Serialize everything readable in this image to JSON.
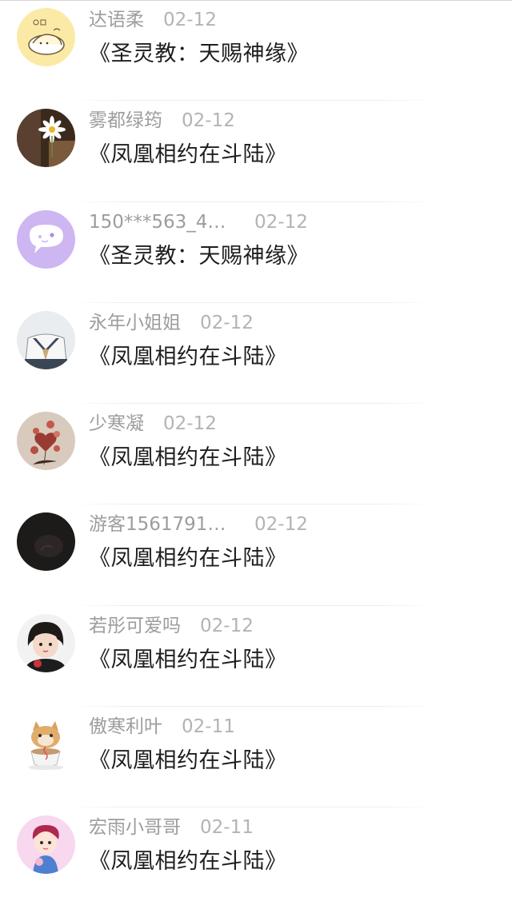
{
  "comments": [
    {
      "user": "达语柔",
      "date": "02-12",
      "book": "《圣灵教：天赐神缘》",
      "avatar": "bread-cat-avatar",
      "avatar_bg": "#fbeaa6"
    },
    {
      "user": "雾都绿筠",
      "date": "02-12",
      "book": "《凤凰相约在斗陆》",
      "avatar": "daisy-photo-avatar",
      "avatar_bg": "#3a2a1e"
    },
    {
      "user": "150***563_4…",
      "date": "02-12",
      "book": "《圣灵教：天赐神缘》",
      "avatar": "chat-bubble-avatar",
      "avatar_bg": "#cdb6f1"
    },
    {
      "user": "永年小姐姐",
      "date": "02-12",
      "book": "《凤凰相约在斗陆》",
      "avatar": "sailor-uniform-avatar",
      "avatar_bg": "#e9edf0"
    },
    {
      "user": "少寒凝",
      "date": "02-12",
      "book": "《凤凰相约在斗陆》",
      "avatar": "heart-balloons-avatar",
      "avatar_bg": "#d8cbbd"
    },
    {
      "user": "游客1561791…",
      "date": "02-12",
      "book": "《凤凰相约在斗陆》",
      "avatar": "dark-photo-avatar",
      "avatar_bg": "#1c1b1a"
    },
    {
      "user": "若彤可爱吗",
      "date": "02-12",
      "book": "《凤凰相约在斗陆》",
      "avatar": "child-photo-avatar",
      "avatar_bg": "#f2f2f2"
    },
    {
      "user": "傲寒利叶",
      "date": "02-11",
      "book": "《凤凰相约在斗陆》",
      "avatar": "cat-teacup-avatar",
      "avatar_bg": "#ffffff"
    },
    {
      "user": "宏雨小哥哥",
      "date": "02-11",
      "book": "《凤凰相约在斗陆》",
      "avatar": "cartoon-boy-avatar",
      "avatar_bg": "#f7d8ee"
    }
  ]
}
